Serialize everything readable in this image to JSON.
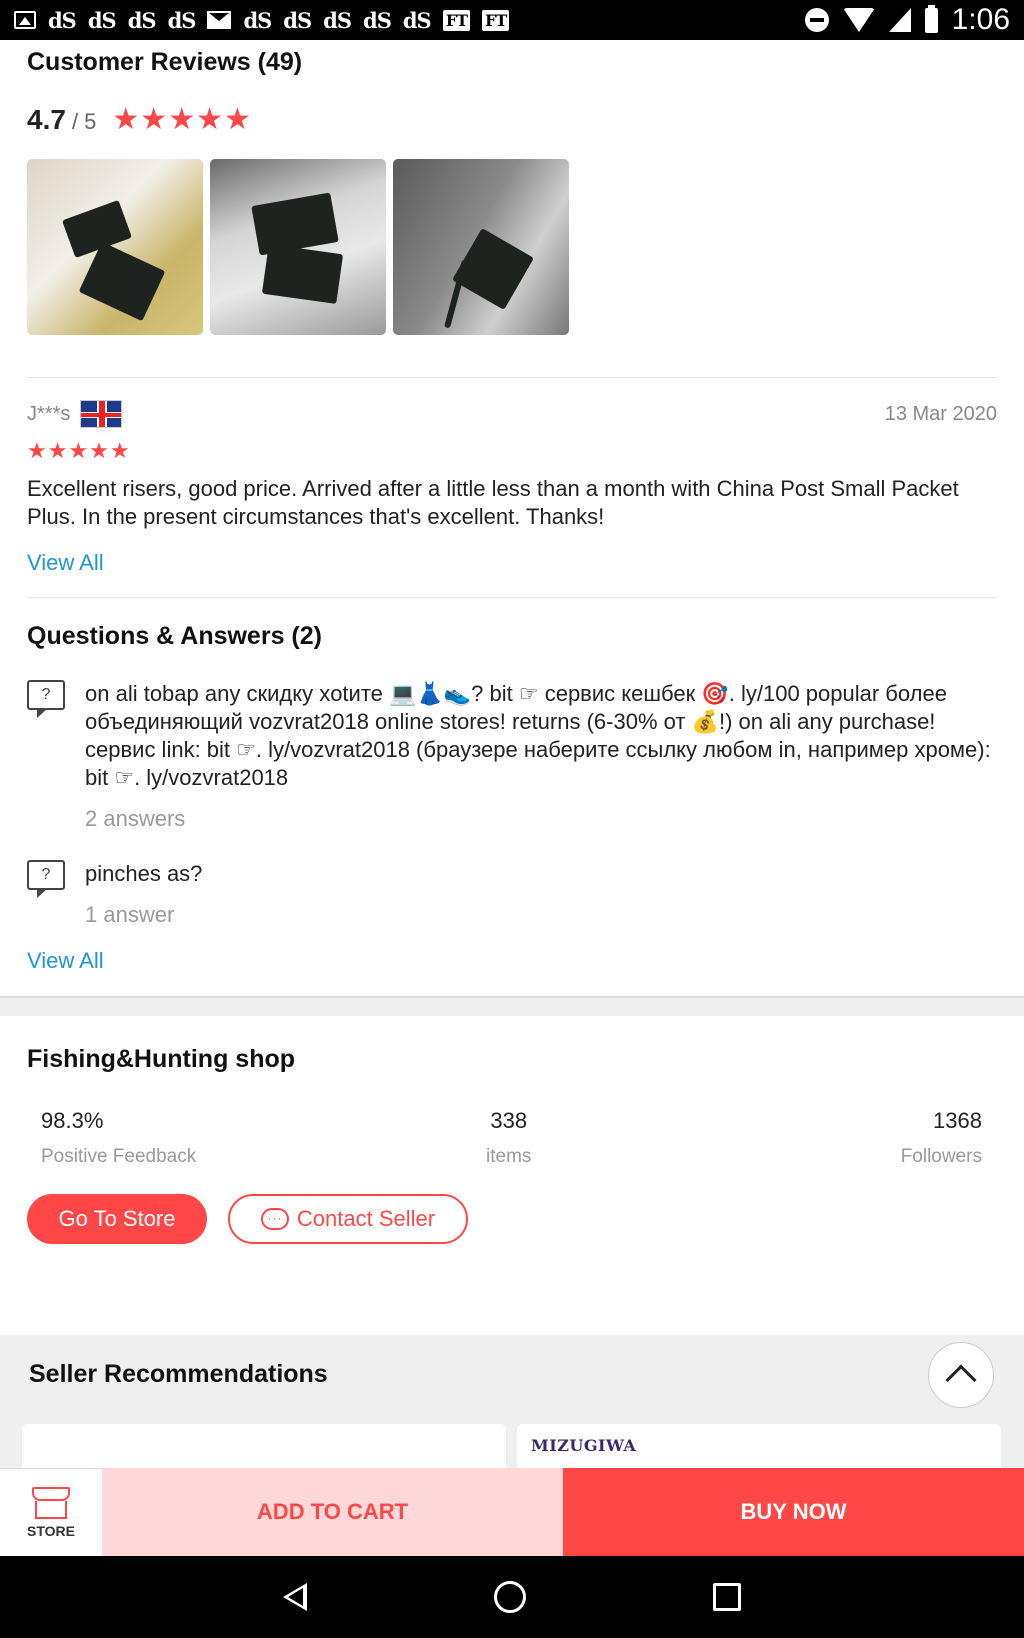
{
  "status_bar": {
    "time": "1:06",
    "notification_icons": [
      "image-icon",
      "dS",
      "dS",
      "dS",
      "dS",
      "gmail-icon",
      "dS",
      "dS",
      "dS",
      "dS",
      "dS",
      "FT",
      "FT"
    ]
  },
  "reviews": {
    "title": "Customer Reviews (49)",
    "rating": "4.7",
    "rating_max": "/ 5",
    "rating_stars": "★★★★★",
    "review": {
      "user": "J***s",
      "date": "13 Mar 2020",
      "stars": "★★★★★",
      "text": "Excellent risers, good price. Arrived after a little less than a month with China Post Small Packet Plus. In the present circumstances that's excellent. Thanks!"
    },
    "view_all": "View All"
  },
  "qa": {
    "title": "Questions & Answers (2)",
    "items": [
      {
        "question": "on ali tobap any скидку xotите 💻👗👟? bit ☞ сервис кешбек 🎯. ly/100 popular более объединяющий vozvrat2018 online stores! returns (6-30% от 💰!) on ali any purchase! сервис link: bit ☞. ly/vozvrat2018 (браузере наберите ссылку любом in, например хроме): bit ☞. ly/vozvrat2018",
        "answers": "2 answers"
      },
      {
        "question": "pinches as?",
        "answers": "1 answer"
      }
    ],
    "view_all": "View All"
  },
  "shop": {
    "name": "Fishing&Hunting shop",
    "stats": [
      {
        "value": "98.3%",
        "label": "Positive Feedback"
      },
      {
        "value": "338",
        "label": "items"
      },
      {
        "value": "1368",
        "label": "Followers"
      }
    ],
    "go_to_store": "Go To Store",
    "contact_seller": "Contact Seller"
  },
  "recommendations": {
    "title": "Seller Recommendations",
    "card_brand": "MIZUGIWA"
  },
  "bottom_bar": {
    "store_label": "STORE",
    "add_to_cart": "ADD TO CART",
    "buy_now": "BUY NOW"
  },
  "colors": {
    "accent": "#ff4747",
    "link": "#2196d3",
    "cart_bg": "#ffd9d9"
  }
}
